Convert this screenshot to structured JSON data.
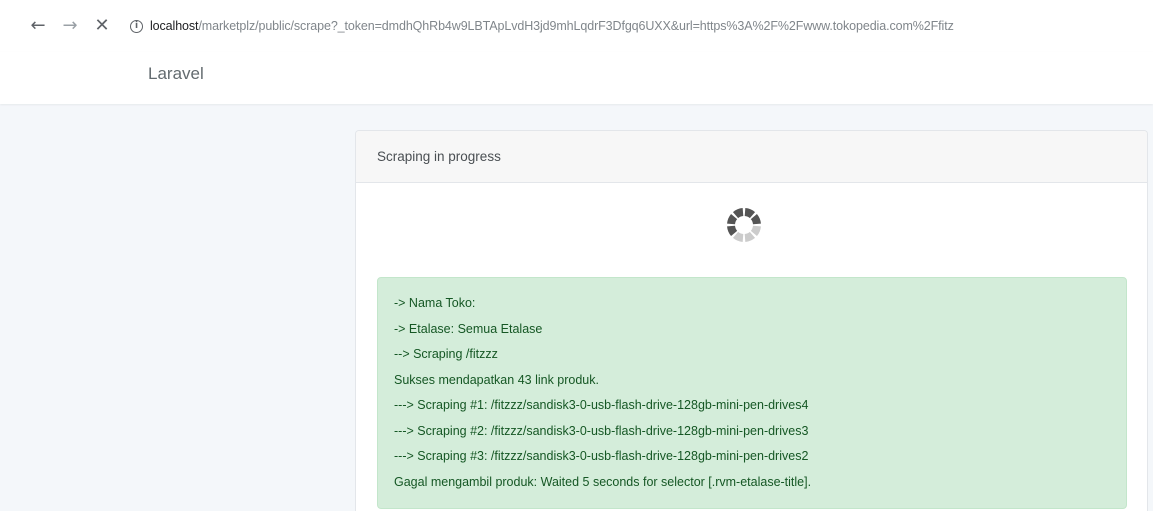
{
  "browser": {
    "back_icon": "←",
    "forward_icon": "→",
    "stop_icon": "✕",
    "info_icon": "i",
    "url_host": "localhost",
    "url_path": "/marketplz/public/scrape?_token=dmdhQhRb4w9LBTApLvdH3jd9mhLqdrF3Dfgq6UXX&url=https%3A%2F%2Fwww.tokopedia.com%2Ffitz"
  },
  "navbar": {
    "brand": "Laravel"
  },
  "card": {
    "header": "Scraping in progress",
    "log": [
      "-> Nama Toko:",
      "-> Etalase: Semua Etalase",
      "--> Scraping /fitzzz",
      "Sukses mendapatkan 43 link produk.",
      "---> Scraping #1: /fitzzz/sandisk3-0-usb-flash-drive-128gb-mini-pen-drives4",
      "---> Scraping #2: /fitzzz/sandisk3-0-usb-flash-drive-128gb-mini-pen-drives3",
      "---> Scraping #3: /fitzzz/sandisk3-0-usb-flash-drive-128gb-mini-pen-drives2",
      "Gagal mengambil produk: Waited 5 seconds for selector [.rvm-etalase-title]."
    ]
  },
  "colors": {
    "page_bg": "#f4f7fa",
    "alert_bg": "#d4edda",
    "alert_text": "#155724",
    "spinner_dark": "#555555",
    "spinner_light": "#cccccc"
  }
}
